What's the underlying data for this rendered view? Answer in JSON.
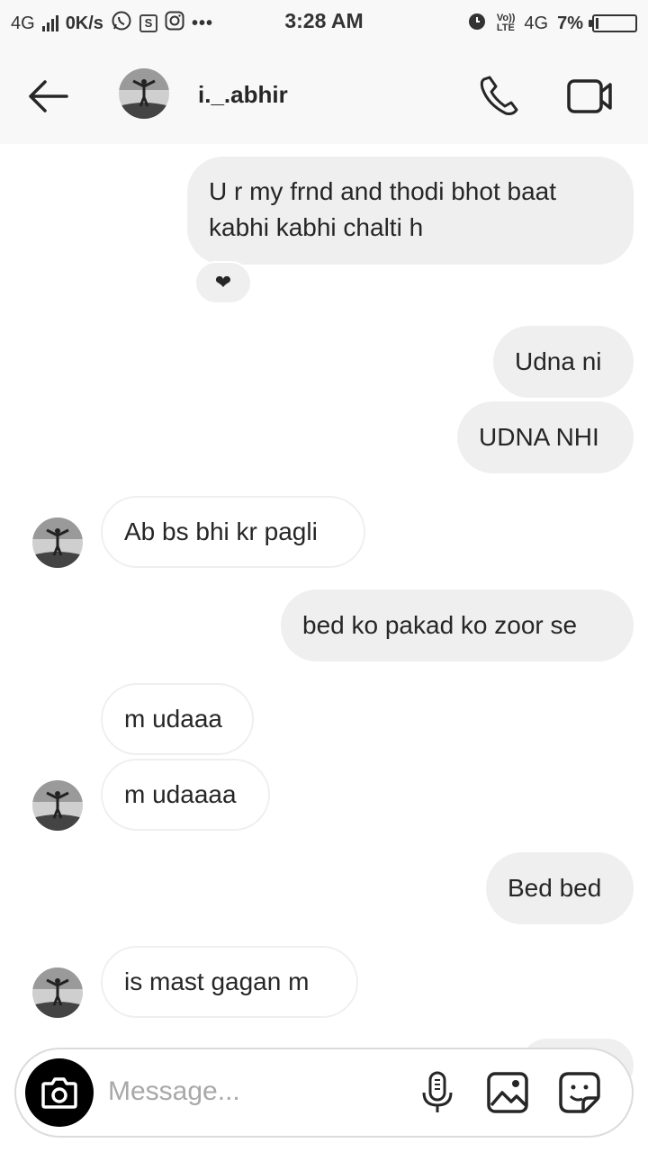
{
  "status_bar": {
    "network": "4G",
    "speed": "0K/s",
    "time": "3:28 AM",
    "lte_top": "Vo))",
    "lte_bottom": "LTE",
    "network_right": "4G",
    "battery": "7%",
    "battery_level": 0.07
  },
  "header": {
    "username": "i._.abhir"
  },
  "messages": [
    {
      "dir": "out",
      "text": "U r my frnd and thodi bhot baat kabhi kabhi chalti h"
    },
    {
      "dir": "out",
      "text": "Udna ni"
    },
    {
      "dir": "out",
      "text": "UDNA NHI"
    },
    {
      "dir": "in",
      "text": "Ab bs bhi kr pagli"
    },
    {
      "dir": "out",
      "text": "bed ko pakad ko zoor se"
    },
    {
      "dir": "in",
      "text": "m udaaa"
    },
    {
      "dir": "in",
      "text": "m udaaaa"
    },
    {
      "dir": "out",
      "text": "Bed bed"
    },
    {
      "dir": "in",
      "text": "is mast gagan m"
    }
  ],
  "reaction": "❤",
  "composer": {
    "placeholder": "Message..."
  },
  "colors": {
    "outgoing_bubble": "#efefef",
    "incoming_border": "#efefef",
    "header_bg": "#f8f8f8",
    "camera_button": "#000000",
    "placeholder": "#a8a8a8"
  },
  "icons": [
    "back-arrow-icon",
    "phone-icon",
    "video-camera-icon",
    "camera-icon",
    "microphone-icon",
    "gallery-icon",
    "sticker-icon",
    "heart-icon",
    "whatsapp-icon",
    "instagram-icon",
    "alarm-icon"
  ]
}
